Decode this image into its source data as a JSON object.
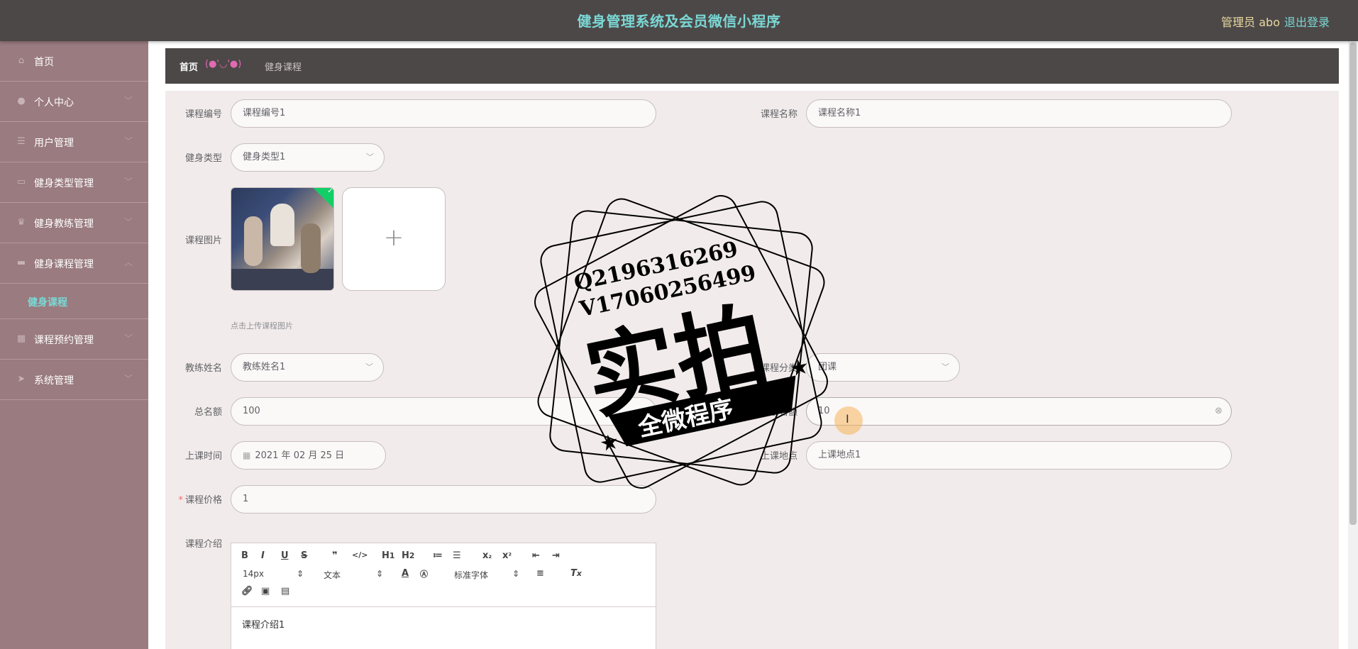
{
  "header": {
    "title": "健身管理系统及会员微信小程序",
    "user": "管理员 abo",
    "logout": "退出登录"
  },
  "sidebar": {
    "items": [
      {
        "label": "首页",
        "icon": "home-icon"
      },
      {
        "label": "个人中心",
        "icon": "user-icon"
      },
      {
        "label": "用户管理",
        "icon": "list-icon"
      },
      {
        "label": "健身类型管理",
        "icon": "doc-icon"
      },
      {
        "label": "健身教练管理",
        "icon": "medal-icon"
      },
      {
        "label": "健身课程管理",
        "icon": "folder-icon"
      }
    ],
    "active_sub": "健身课程",
    "items_after": [
      {
        "label": "课程预约管理",
        "icon": "grid-icon"
      },
      {
        "label": "系统管理",
        "icon": "send-icon"
      }
    ]
  },
  "breadcrumb": {
    "home": "首页",
    "separator": "(●'◡'●)",
    "current": "健身课程"
  },
  "form": {
    "course_no_label": "课程编号",
    "course_no_value": "课程编号1",
    "course_name_label": "课程名称",
    "course_name_value": "课程名称1",
    "fitness_type_label": "健身类型",
    "fitness_type_value": "健身类型1",
    "image_label": "课程图片",
    "image_hint": "点击上传课程图片",
    "coach_label": "教练姓名",
    "coach_value": "教练姓名1",
    "category_label": "课程分类",
    "category_value": "团课",
    "total_label": "总名额",
    "total_value": "100",
    "remaining_label": "剩余名额",
    "remaining_value": "10",
    "time_label": "上课时间",
    "time_value": "2021 年 02 月 25 日",
    "place_label": "上课地点",
    "place_value": "上课地点1",
    "price_label": "课程价格",
    "price_value": "1",
    "intro_label": "课程介绍",
    "intro_value": "课程介绍1"
  },
  "editor": {
    "font_size": "14px",
    "format": "文本",
    "font": "标准字体"
  },
  "watermark": {
    "line1": "Q2196316269",
    "line2": "V17060256499",
    "big": "实拍",
    "banner": "全微程序"
  },
  "colors": {
    "header_bg": "#4d4848",
    "sidebar_bg": "#9a7b7f",
    "accent": "#7ad8d5",
    "form_bg": "#f2ebeb"
  }
}
